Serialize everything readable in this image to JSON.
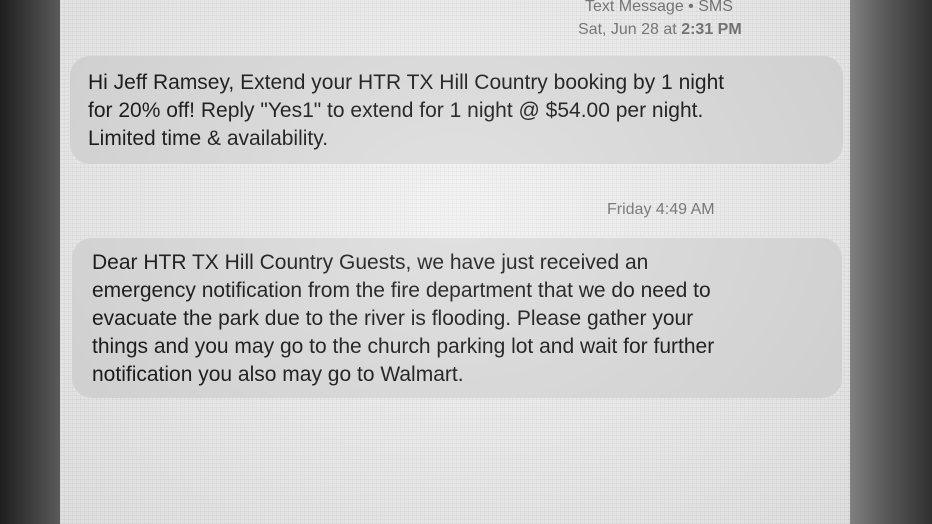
{
  "thread": {
    "header_service": "Text Message • SMS",
    "header_date": "Sat, Jun 28 at",
    "header_time": "2:31 PM"
  },
  "messages": [
    {
      "lines": [
        "Hi Jeff Ramsey, Extend your HTR TX Hill Country booking by 1 night",
        "for 20% off! Reply \"Yes1\" to extend for 1 night @ $54.00 per night.",
        "Limited time & availability."
      ]
    },
    {
      "timestamp": "Friday 4:49 AM",
      "lines": [
        "Dear HTR TX Hill Country Guests, we have just received an",
        "emergency notification from the fire department that we do need to",
        "evacuate the park due to the river is flooding. Please gather your",
        "things and you may go to the church parking lot and wait for further",
        "notification you also may go to Walmart."
      ]
    }
  ]
}
